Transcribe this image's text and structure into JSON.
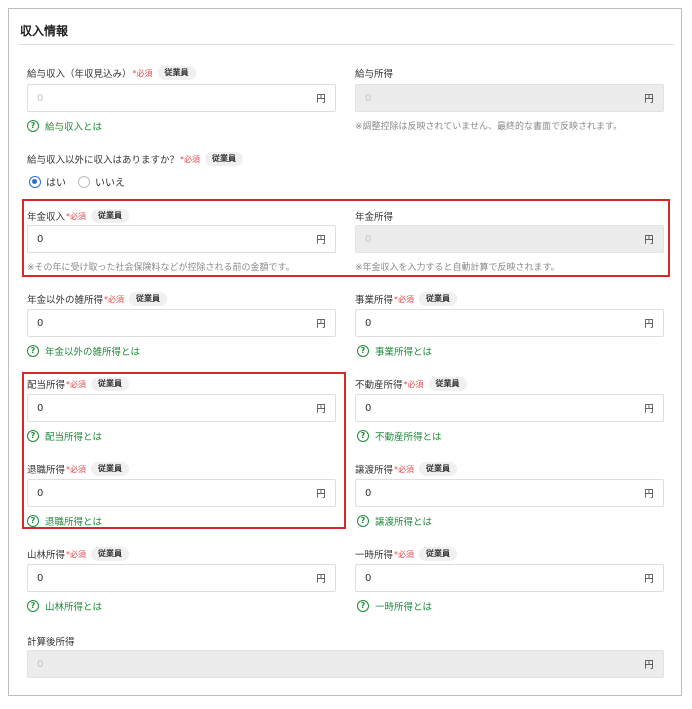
{
  "section_title": "収入情報",
  "required_mark": "*必須",
  "employee_badge": "従業員",
  "unit": "円",
  "salary_income": {
    "label": "給与収入（年収見込み）",
    "placeholder": "0",
    "help_link": "給与収入とは"
  },
  "salary_deduction_income": {
    "label": "給与所得",
    "placeholder": "0",
    "note": "※調整控除は反映されていません、最終的な書面で反映されます。"
  },
  "other_income_question": {
    "label": "給与収入以外に収入はありますか？",
    "options": [
      "はい",
      "いいえ"
    ],
    "selected": "はい"
  },
  "pension_income": {
    "label": "年金収入",
    "value": "0",
    "note": "※その年に受け取った社会保険料などが控除される前の金額です。"
  },
  "pension_deduction_income": {
    "label": "年金所得",
    "placeholder": "0",
    "note": "※年金収入を入力すると自動計算で反映されます。"
  },
  "misc_income": {
    "label": "年金以外の雑所得",
    "value": "0",
    "help_link": "年金以外の雑所得とは"
  },
  "business_income": {
    "label": "事業所得",
    "value": "0",
    "help_link": "事業所得とは"
  },
  "dividend_income": {
    "label": "配当所得",
    "value": "0",
    "help_link": "配当所得とは"
  },
  "real_estate_income": {
    "label": "不動産所得",
    "value": "0",
    "help_link": "不動産所得とは"
  },
  "retirement_income": {
    "label": "退職所得",
    "value": "0",
    "help_link": "退職所得とは"
  },
  "transfer_income": {
    "label": "譲渡所得",
    "value": "0",
    "help_link": "譲渡所得とは"
  },
  "forest_income": {
    "label": "山林所得",
    "value": "0",
    "help_link": "山林所得とは"
  },
  "temporary_income": {
    "label": "一時所得",
    "value": "0",
    "help_link": "一時所得とは"
  },
  "calculated_income": {
    "label": "計算後所得",
    "placeholder": "0"
  },
  "colors": {
    "accent": "#2a6dd9",
    "link": "#1e8a3a",
    "required": "#e5484d",
    "highlight": "#d62828"
  }
}
